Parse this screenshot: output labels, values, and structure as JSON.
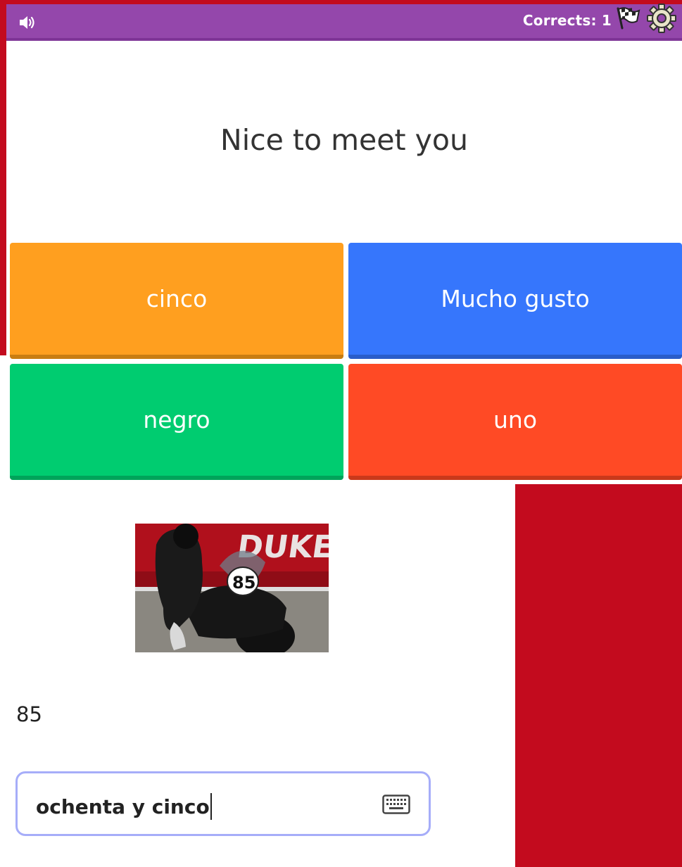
{
  "topbar": {
    "bg_color": "#9447ab",
    "speaker_icon": "speaker-icon",
    "corrects_label": "Corrects:",
    "corrects_value": "1",
    "flag_icon": "checkered-flag-icon",
    "settings_icon": "gear-icon"
  },
  "question": {
    "prompt": "Nice to meet you"
  },
  "answers": [
    {
      "label": "cinco",
      "color": "#ff9f1f"
    },
    {
      "label": "Mucho gusto",
      "color": "#3676fc"
    },
    {
      "label": "negro",
      "color": "#00cc70"
    },
    {
      "label": "uno",
      "color": "#ff4a25"
    }
  ],
  "overlay": {
    "photo_number": "85",
    "number_text": "85",
    "input_value": "ochenta y cinco",
    "keyboard_icon": "keyboard-icon",
    "accent_red": "#c30b1e"
  }
}
